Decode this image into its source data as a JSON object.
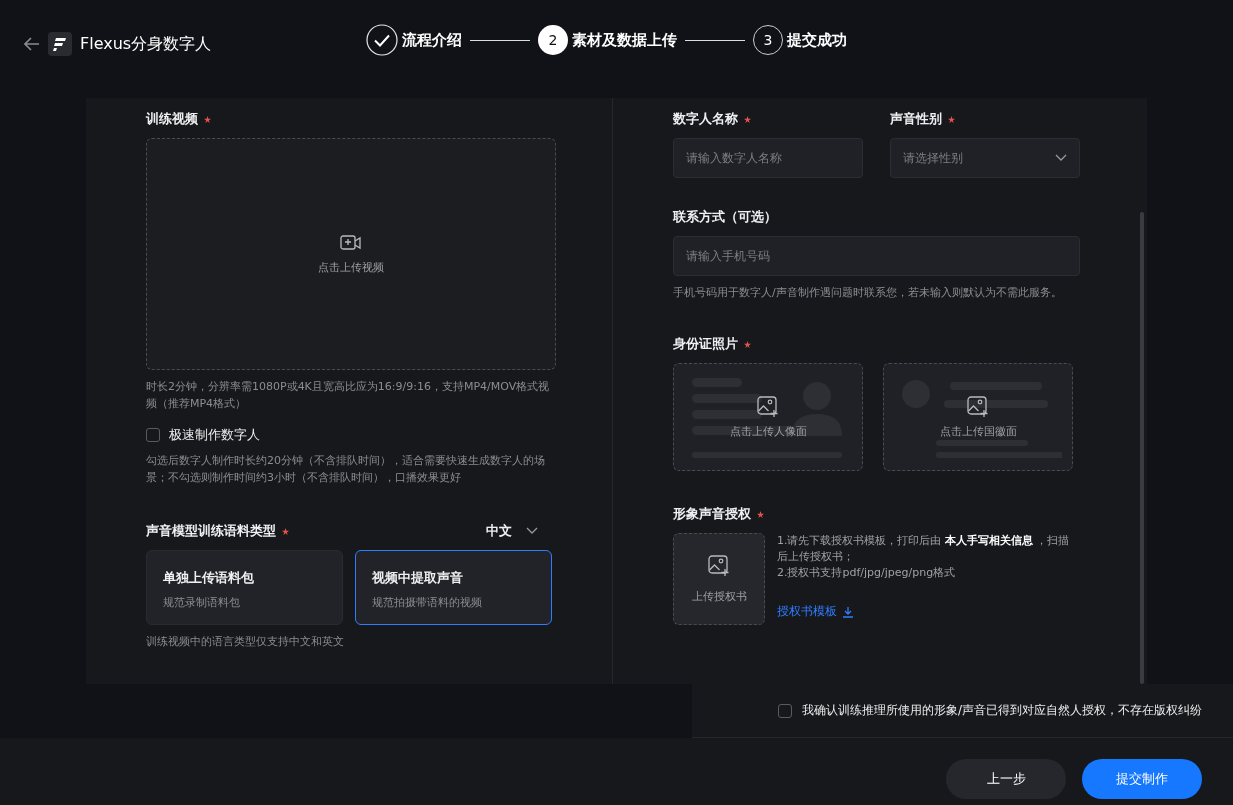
{
  "header": {
    "title": "Flexus分身数字人",
    "steps": [
      {
        "label": "流程介绍",
        "completed": true,
        "selected": false
      },
      {
        "number": "2",
        "label": "素材及数据上传",
        "completed": false,
        "selected": true
      },
      {
        "number": "3",
        "label": "提交成功",
        "completed": false,
        "selected": false
      }
    ]
  },
  "left": {
    "video": {
      "label": "训练视频",
      "required": true,
      "upload_text": "点击上传视频",
      "hint": "时长2分钟，分辨率需1080P或4K且宽高比应为16:9/9:16，支持MP4/MOV格式视频（推荐MP4格式）"
    },
    "fast": {
      "label": "极速制作数字人",
      "checked": false,
      "description": "勾选后数字人制作时长约20分钟（不含排队时间），适合需要快速生成数字人的场景；不勾选则制作时间约3小时（不含排队时间），口播效果更好"
    },
    "voice": {
      "label": "声音模型训练语料类型",
      "required": true,
      "language": "中文",
      "options": [
        {
          "title": "单独上传语料包",
          "subtitle": "规范录制语料包",
          "selected": false
        },
        {
          "title": "视频中提取声音",
          "subtitle": "规范拍摄带语料的视频",
          "selected": true
        }
      ],
      "hint": "训练视频中的语言类型仅支持中文和英文"
    }
  },
  "right": {
    "name": {
      "label": "数字人名称",
      "required": true,
      "placeholder": "请输入数字人名称"
    },
    "gender": {
      "label": "声音性别",
      "required": true,
      "placeholder": "请选择性别"
    },
    "contact": {
      "label": "联系方式（可选）",
      "placeholder": "请输入手机号码",
      "hint": "手机号码用于数字人/声音制作遇问题时联系您，若未输入则默认为不需此服务。"
    },
    "id_photos": {
      "label": "身份证照片",
      "required": true,
      "items": [
        {
          "kind": "portrait",
          "text": "点击上传人像面"
        },
        {
          "kind": "emblem",
          "text": "点击上传国徽面"
        }
      ]
    },
    "authorization": {
      "label": "形象声音授权",
      "required": true,
      "upload_text": "上传授权书",
      "instructions": [
        "1.请先下载授权书模板，打印后由 **本人手写相关信息** ，扫描后上传授权书；",
        "2.授权书支持pdf/jpg/jpeg/png格式"
      ],
      "template_link": "授权书模板"
    }
  },
  "footer": {
    "consent": {
      "text": "我确认训练推理所使用的形象/声音已得到对应自然人授权，不存在版权纠纷",
      "checked": false
    },
    "buttons": [
      {
        "label": "上一步",
        "kind": "secondary"
      },
      {
        "label": "提交制作",
        "kind": "primary"
      }
    ]
  }
}
